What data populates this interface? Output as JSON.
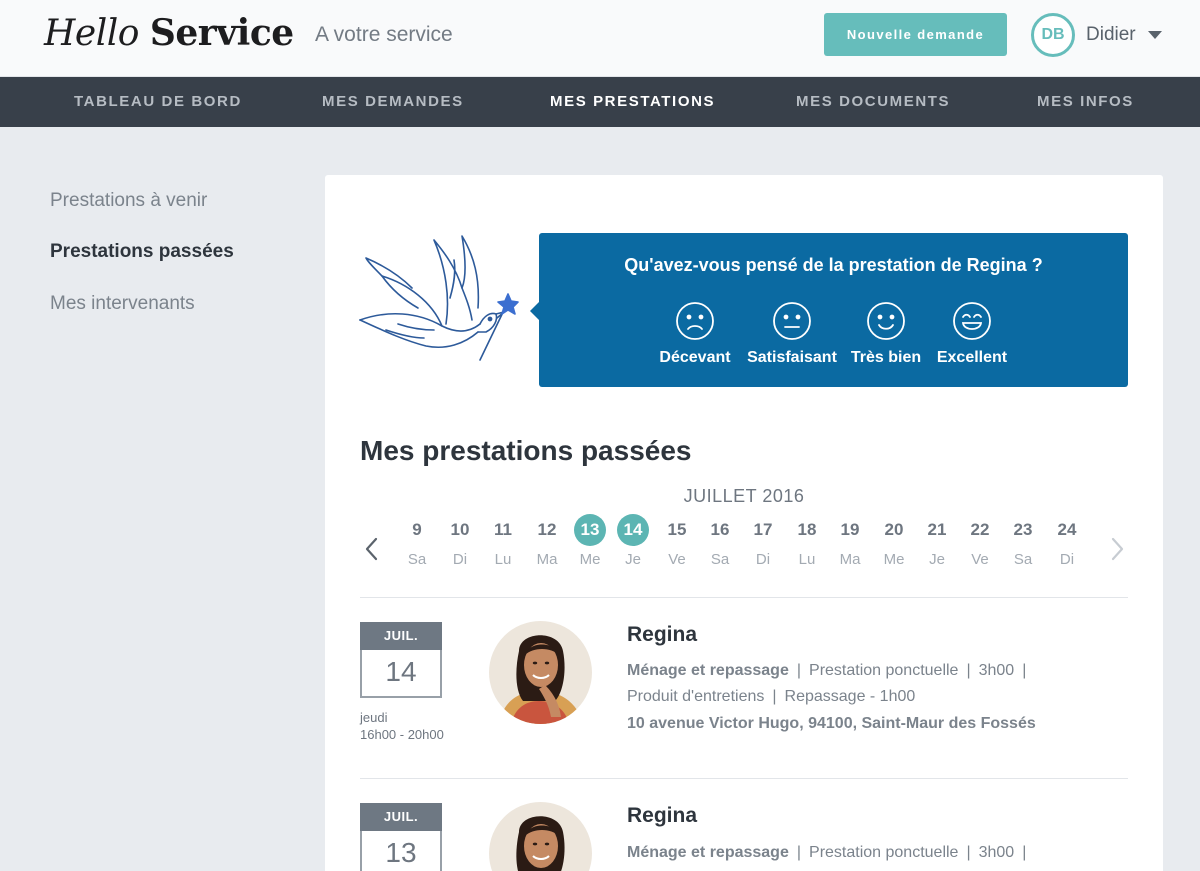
{
  "header": {
    "logo_part1": "Hello",
    "logo_part2": "Service",
    "tagline": "A votre service",
    "new_request_label": "Nouvelle demande",
    "user_initials": "DB",
    "user_name": "Didier",
    "accent_color": "#66bdbb"
  },
  "nav": {
    "items": [
      {
        "label": "TABLEAU DE BORD"
      },
      {
        "label": "MES DEMANDES"
      },
      {
        "label": "MES PRESTATIONS",
        "active": true
      },
      {
        "label": "MES DOCUMENTS"
      },
      {
        "label": "MES INFOS"
      }
    ]
  },
  "sidebar": {
    "items": [
      {
        "label": "Prestations à venir"
      },
      {
        "label": "Prestations passées",
        "active": true
      },
      {
        "label": "Mes intervenants"
      }
    ]
  },
  "rating": {
    "question": "Qu'avez-vous pensé de la prestation de Regina ?",
    "box_color": "#0b6aa2",
    "options": [
      {
        "label": "Décevant",
        "icon": "sad-face-icon"
      },
      {
        "label": "Satisfaisant",
        "icon": "neutral-face-icon"
      },
      {
        "label": "Très bien",
        "icon": "smile-face-icon"
      },
      {
        "label": "Excellent",
        "icon": "grin-face-icon"
      }
    ]
  },
  "section_title": "Mes prestations passées",
  "calendar": {
    "month": "JUILLET 2016",
    "days": [
      {
        "num": "9",
        "wd": "Sa"
      },
      {
        "num": "10",
        "wd": "Di"
      },
      {
        "num": "11",
        "wd": "Lu"
      },
      {
        "num": "12",
        "wd": "Ma"
      },
      {
        "num": "13",
        "wd": "Me",
        "active": true
      },
      {
        "num": "14",
        "wd": "Je",
        "active": true
      },
      {
        "num": "15",
        "wd": "Ve"
      },
      {
        "num": "16",
        "wd": "Sa"
      },
      {
        "num": "17",
        "wd": "Di"
      },
      {
        "num": "18",
        "wd": "Lu"
      },
      {
        "num": "19",
        "wd": "Ma"
      },
      {
        "num": "20",
        "wd": "Me"
      },
      {
        "num": "21",
        "wd": "Je"
      },
      {
        "num": "22",
        "wd": "Ve"
      },
      {
        "num": "23",
        "wd": "Sa"
      },
      {
        "num": "24",
        "wd": "Di"
      }
    ]
  },
  "prestations": [
    {
      "month": "JUIL.",
      "day": "14",
      "weekday": "jeudi",
      "hours": "16h00 - 20h00",
      "name": "Regina",
      "service": "Ménage et repassage",
      "type": "Prestation ponctuelle",
      "duration": "3h00",
      "extra1": "Produit d'entretiens",
      "extra2": "Repassage - 1h00",
      "address": "10 avenue Victor Hugo, 94100, Saint-Maur des Fossés"
    },
    {
      "month": "JUIL.",
      "day": "13",
      "name": "Regina",
      "service": "Ménage et repassage",
      "type": "Prestation ponctuelle",
      "duration": "3h00"
    }
  ]
}
